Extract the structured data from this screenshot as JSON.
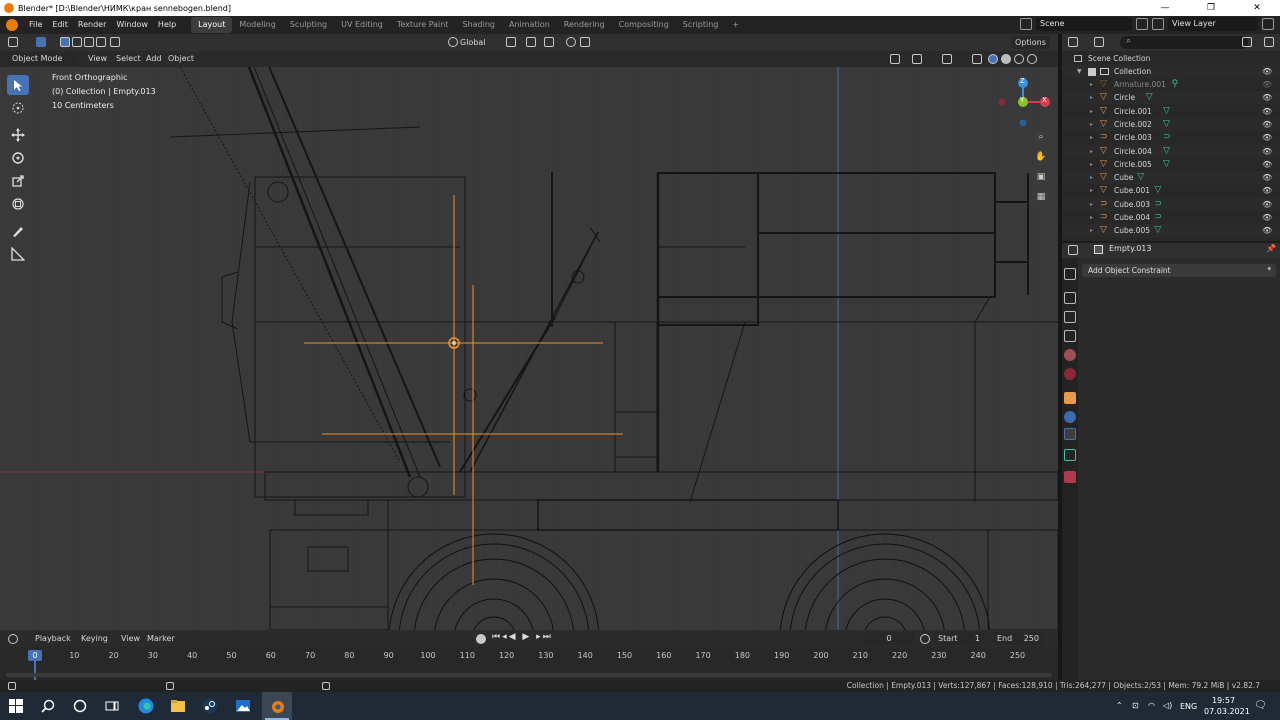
{
  "window": {
    "title": "Blender* [D:\\Blender\\НИМК\\кран sennebogen.blend]",
    "minimize": "—",
    "maximize": "❐",
    "close": "✕"
  },
  "menu": [
    "File",
    "Edit",
    "Render",
    "Window",
    "Help"
  ],
  "workspaces": [
    "Layout",
    "Modeling",
    "Sculpting",
    "UV Editing",
    "Texture Paint",
    "Shading",
    "Animation",
    "Rendering",
    "Compositing",
    "Scripting",
    "+"
  ],
  "scene": {
    "label": "Scene",
    "view_layer": "View Layer"
  },
  "viewport_header": {
    "transform_orientation": "Global",
    "options_label": "Options"
  },
  "viewport_header2": {
    "mode": "Object Mode",
    "menus": [
      "View",
      "Select",
      "Add",
      "Object"
    ]
  },
  "viewport_info": {
    "view_name": "Front Orthographic",
    "object_path": "(0) Collection | Empty.013",
    "scale": "10 Centimeters"
  },
  "gizmo": {
    "z": "Z",
    "y": "Y",
    "x": "X"
  },
  "colors": {
    "accent": "#4772b3",
    "selection": "#f0932b",
    "x_axis": "#d93d50",
    "y_axis": "#8ac52e",
    "z_axis": "#3b8fe0",
    "mesh_icon": "#3fc2a6",
    "object_icon": "#e89a4b"
  },
  "timeline": {
    "menus": [
      "Playback",
      "Keying",
      "View",
      "Marker"
    ],
    "current_frame": "0",
    "start_label": "Start",
    "start": "1",
    "end_label": "End",
    "end": "250",
    "ruler": [
      "0",
      "10",
      "20",
      "30",
      "40",
      "50",
      "60",
      "70",
      "80",
      "90",
      "100",
      "110",
      "120",
      "130",
      "140",
      "150",
      "160",
      "170",
      "180",
      "190",
      "200",
      "210",
      "220",
      "230",
      "240",
      "250"
    ]
  },
  "outliner": {
    "scene_collection": "Scene Collection",
    "collection": "Collection",
    "items": [
      {
        "name": "Armature.001",
        "icon": "armature-icon",
        "dim": true
      },
      {
        "name": "Circle",
        "icon": "mesh-icon"
      },
      {
        "name": "Circle.001",
        "icon": "mesh-icon"
      },
      {
        "name": "Circle.002",
        "icon": "mesh-icon"
      },
      {
        "name": "Circle.003",
        "icon": "curve-icon"
      },
      {
        "name": "Circle.004",
        "icon": "mesh-icon"
      },
      {
        "name": "Circle.005",
        "icon": "mesh-icon"
      },
      {
        "name": "Cube",
        "icon": "mesh-icon"
      },
      {
        "name": "Cube.001",
        "icon": "mesh-icon"
      },
      {
        "name": "Cube.003",
        "icon": "curve-icon"
      },
      {
        "name": "Cube.004",
        "icon": "curve-icon"
      },
      {
        "name": "Cube.005",
        "icon": "mesh-icon"
      }
    ]
  },
  "properties": {
    "object_name": "Empty.013",
    "add_constraint": "Add Object Constraint"
  },
  "statusbar": {
    "stats": "Collection | Empty.013 | Verts:127,867 | Faces:128,910 | Tris:264,277 | Objects:2/53 | Mem: 79.2 MiB | v2.82.7"
  },
  "taskbar": {
    "language": "ENG",
    "time": "19:57",
    "date": "07.03.2021"
  }
}
